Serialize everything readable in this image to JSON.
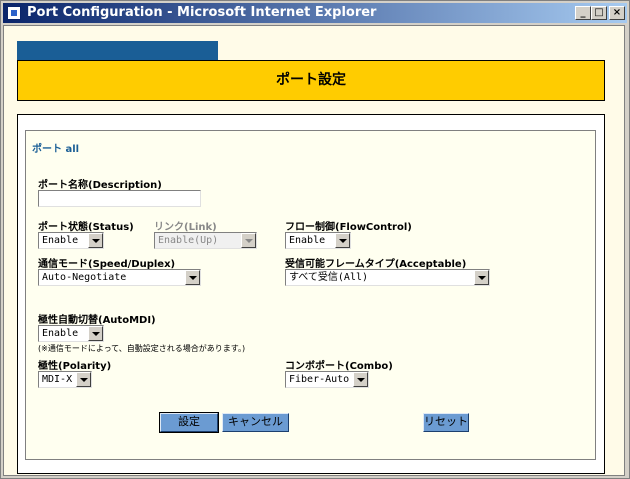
{
  "window": {
    "title": "Port Configuration - Microsoft Internet Explorer",
    "minimize": "_",
    "maximize": "□",
    "close": "×"
  },
  "page": {
    "header": "ポート設定",
    "port_label": "ポート all"
  },
  "form": {
    "description": {
      "label": "ポート名称(Description)",
      "value": ""
    },
    "status": {
      "label": "ポート状態(Status)",
      "value": "Enable"
    },
    "link": {
      "label": "リンク(Link)",
      "value": "Enable(Up)"
    },
    "flow_control": {
      "label": "フロー制御(FlowControl)",
      "value": "Enable"
    },
    "speed_duplex": {
      "label": "通信モード(Speed/Duplex)",
      "value": "Auto-Negotiate"
    },
    "acceptable": {
      "label": "受信可能フレームタイプ(Acceptable)",
      "value": "すべて受信(All)"
    },
    "auto_mdi": {
      "label": "極性自動切替(AutoMDI)",
      "value": "Enable",
      "note": "(※通信モードによって、自動設定される場合があります。)"
    },
    "polarity": {
      "label": "極性(Polarity)",
      "value": "MDI-X"
    },
    "combo": {
      "label": "コンボポート(Combo)",
      "value": "Fiber-Auto"
    }
  },
  "buttons": {
    "apply": "設定",
    "cancel": "キャンセル",
    "reset": "リセット"
  },
  "colors": {
    "header_bg": "#ffcc00",
    "tab_bg": "#1a5e96",
    "button_bg": "#6b9bd2"
  }
}
